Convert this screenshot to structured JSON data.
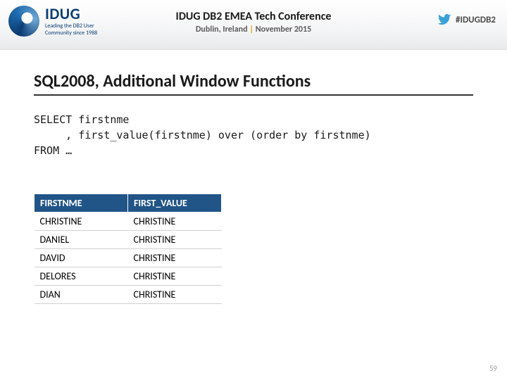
{
  "header": {
    "logo": {
      "acronym": "IDUG",
      "tagline1": "Leading the DB2 User",
      "tagline2": "Community since 1988"
    },
    "conf_line1": "IDUG DB2 EMEA Tech Conference",
    "conf_loc": "Dublin, Ireland",
    "conf_sep": "|",
    "conf_date": "November 2015",
    "hashtag": "#IDUGDB2"
  },
  "slide": {
    "title": "SQL2008, Additional Window Functions",
    "code_line1": "SELECT firstnme",
    "code_line2": "     , first_value(firstnme) over (order by firstnme)",
    "code_line3": "FROM …"
  },
  "table": {
    "headers": [
      "FIRSTNME",
      "FIRST_VALUE"
    ],
    "rows": [
      [
        "CHRISTINE",
        "CHRISTINE"
      ],
      [
        "DANIEL",
        "CHRISTINE"
      ],
      [
        "DAVID",
        "CHRISTINE"
      ],
      [
        "DELORES",
        "CHRISTINE"
      ],
      [
        "DIAN",
        "CHRISTINE"
      ]
    ]
  },
  "page_number": "59"
}
